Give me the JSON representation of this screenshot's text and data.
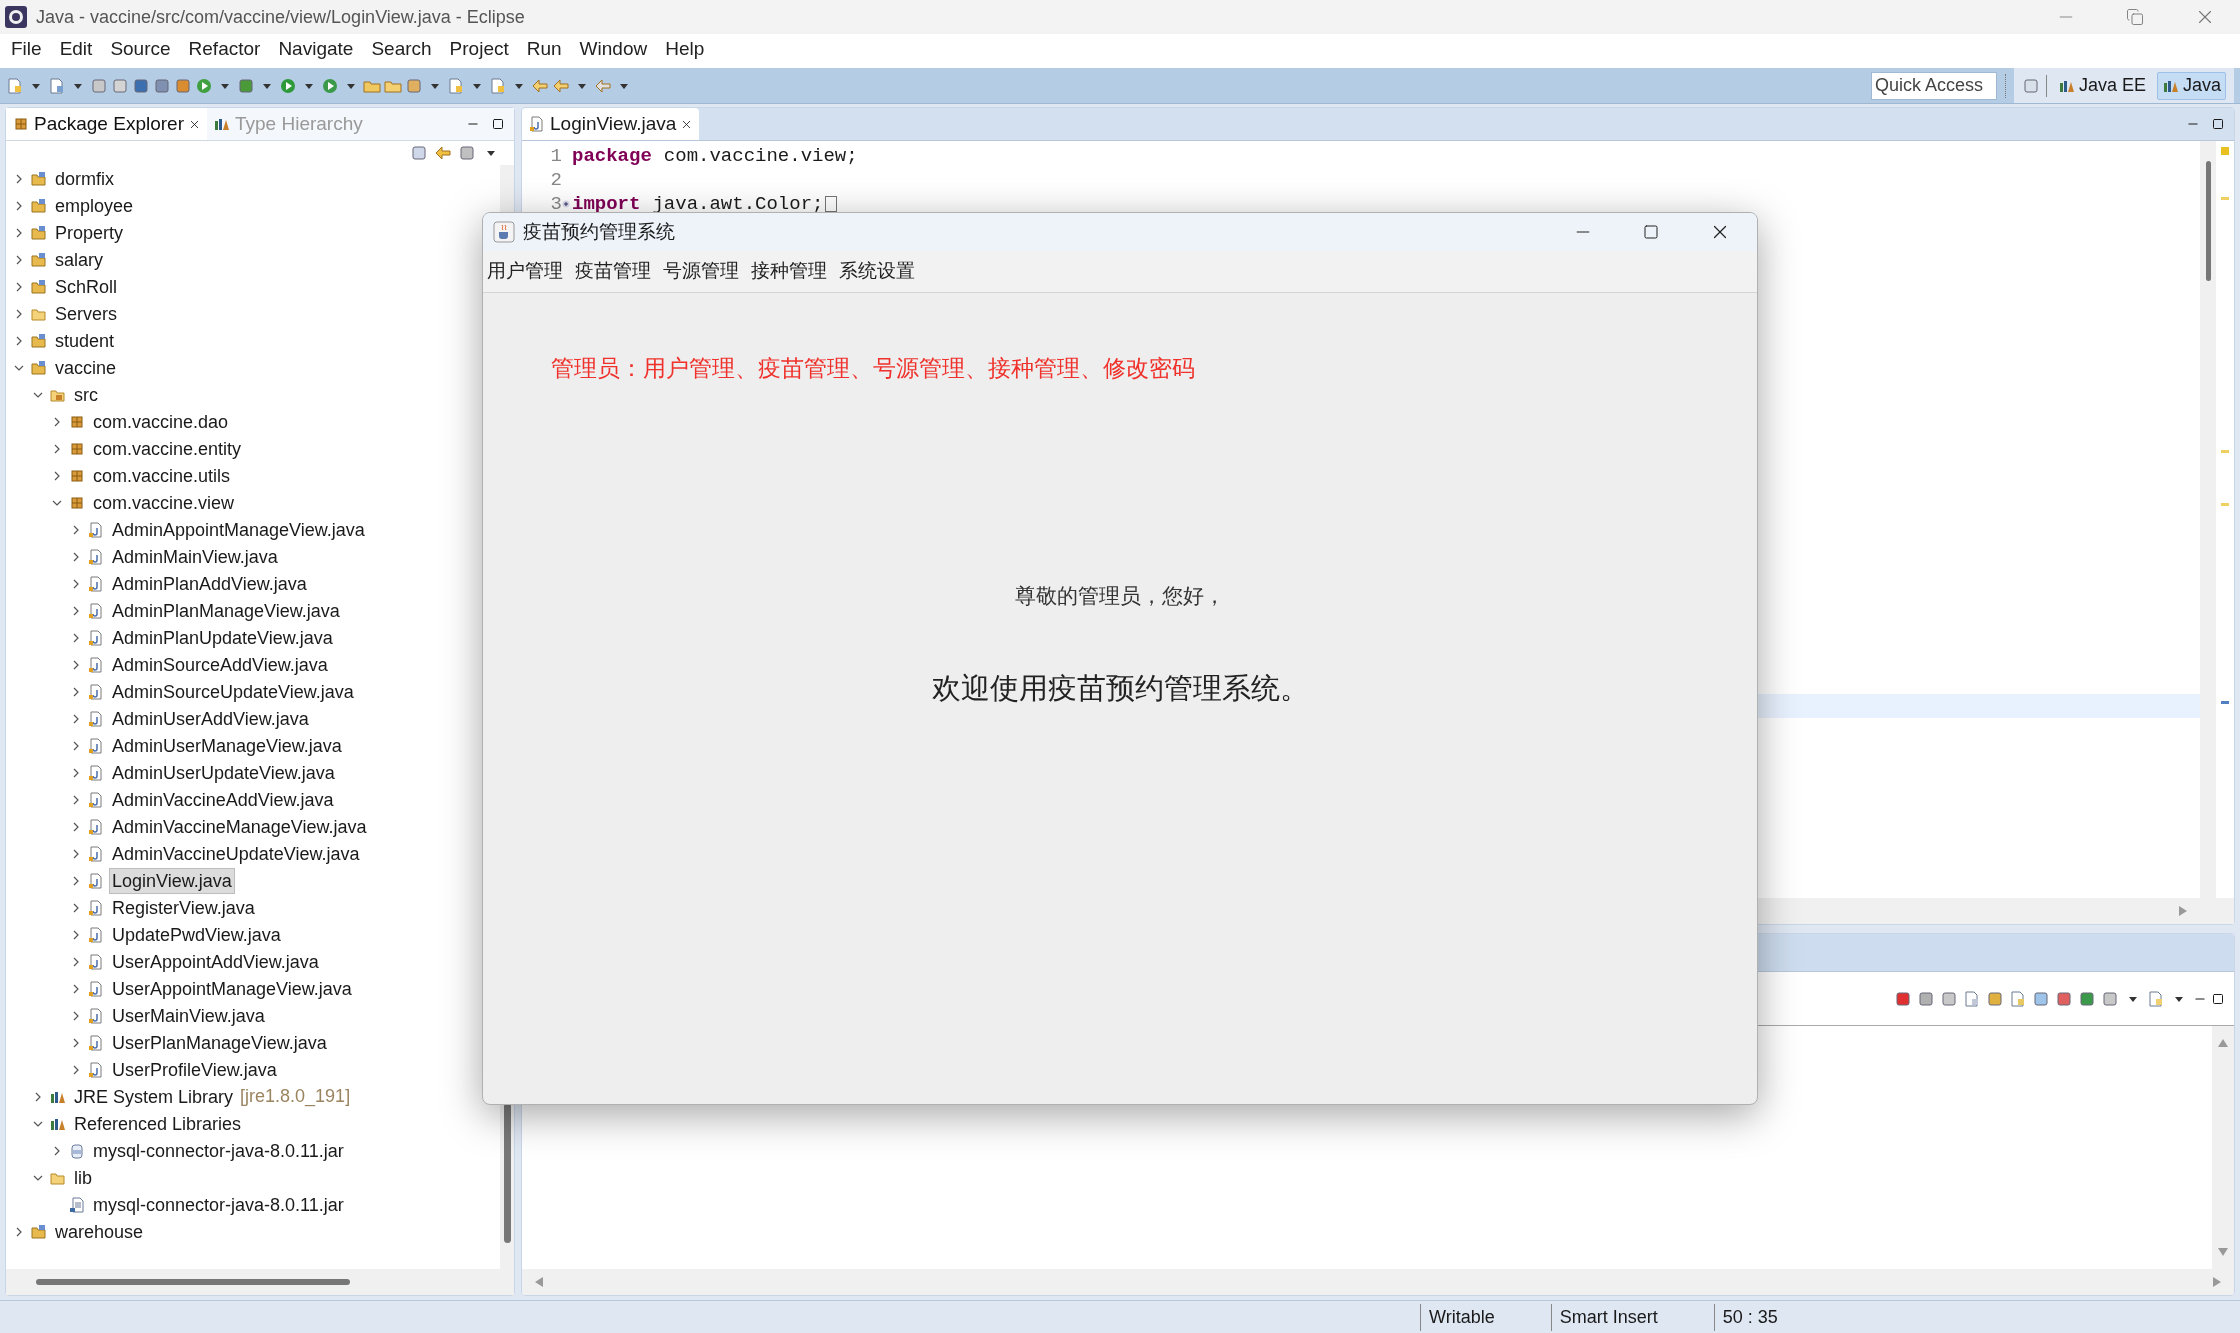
{
  "window": {
    "title": "Java - vaccine/src/com/vaccine/view/LoginView.java - Eclipse"
  },
  "menu": [
    "File",
    "Edit",
    "Source",
    "Refactor",
    "Navigate",
    "Search",
    "Project",
    "Run",
    "Window",
    "Help"
  ],
  "quick_access": {
    "placeholder": "Quick Access"
  },
  "perspectives": [
    {
      "label": "Java EE",
      "selected": false
    },
    {
      "label": "Java",
      "selected": true
    }
  ],
  "left_tabs": [
    {
      "label": "Package Explorer",
      "selected": true
    },
    {
      "label": "Type Hierarchy",
      "selected": false
    }
  ],
  "tree": [
    {
      "label": "dormfix",
      "kind": "project",
      "expanded": false,
      "selected": false
    },
    {
      "label": "employee",
      "kind": "project",
      "expanded": false,
      "selected": false
    },
    {
      "label": "Property",
      "kind": "project",
      "expanded": false,
      "selected": false
    },
    {
      "label": "salary",
      "kind": "project",
      "expanded": false,
      "selected": false
    },
    {
      "label": "SchRoll",
      "kind": "project",
      "expanded": false,
      "selected": false
    },
    {
      "label": "Servers",
      "kind": "folder",
      "expanded": false,
      "selected": false
    },
    {
      "label": "student",
      "kind": "project",
      "expanded": false,
      "selected": false
    },
    {
      "label": "vaccine",
      "kind": "project",
      "expanded": true,
      "selected": false,
      "children": [
        {
          "label": "src",
          "kind": "src",
          "expanded": true,
          "selected": false,
          "children": [
            {
              "label": "com.vaccine.dao",
              "kind": "package",
              "expanded": false,
              "selected": false
            },
            {
              "label": "com.vaccine.entity",
              "kind": "package",
              "expanded": false,
              "selected": false
            },
            {
              "label": "com.vaccine.utils",
              "kind": "package",
              "expanded": false,
              "selected": false
            },
            {
              "label": "com.vaccine.view",
              "kind": "package",
              "expanded": true,
              "selected": false,
              "children": [
                {
                  "label": "AdminAppointManageView.java",
                  "kind": "java",
                  "expanded": false,
                  "selected": false
                },
                {
                  "label": "AdminMainView.java",
                  "kind": "java",
                  "expanded": false,
                  "selected": false
                },
                {
                  "label": "AdminPlanAddView.java",
                  "kind": "java",
                  "expanded": false,
                  "selected": false
                },
                {
                  "label": "AdminPlanManageView.java",
                  "kind": "java",
                  "expanded": false,
                  "selected": false
                },
                {
                  "label": "AdminPlanUpdateView.java",
                  "kind": "java",
                  "expanded": false,
                  "selected": false
                },
                {
                  "label": "AdminSourceAddView.java",
                  "kind": "java",
                  "expanded": false,
                  "selected": false
                },
                {
                  "label": "AdminSourceUpdateView.java",
                  "kind": "java",
                  "expanded": false,
                  "selected": false
                },
                {
                  "label": "AdminUserAddView.java",
                  "kind": "java",
                  "expanded": false,
                  "selected": false
                },
                {
                  "label": "AdminUserManageView.java",
                  "kind": "java",
                  "expanded": false,
                  "selected": false
                },
                {
                  "label": "AdminUserUpdateView.java",
                  "kind": "java",
                  "expanded": false,
                  "selected": false
                },
                {
                  "label": "AdminVaccineAddView.java",
                  "kind": "java",
                  "expanded": false,
                  "selected": false
                },
                {
                  "label": "AdminVaccineManageView.java",
                  "kind": "java",
                  "expanded": false,
                  "selected": false
                },
                {
                  "label": "AdminVaccineUpdateView.java",
                  "kind": "java",
                  "expanded": false,
                  "selected": false
                },
                {
                  "label": "LoginView.java",
                  "kind": "java",
                  "expanded": false,
                  "selected": true
                },
                {
                  "label": "RegisterView.java",
                  "kind": "java",
                  "expanded": false,
                  "selected": false
                },
                {
                  "label": "UpdatePwdView.java",
                  "kind": "java",
                  "expanded": false,
                  "selected": false
                },
                {
                  "label": "UserAppointAddView.java",
                  "kind": "java",
                  "expanded": false,
                  "selected": false
                },
                {
                  "label": "UserAppointManageView.java",
                  "kind": "java",
                  "expanded": false,
                  "selected": false
                },
                {
                  "label": "UserMainView.java",
                  "kind": "java",
                  "expanded": false,
                  "selected": false
                },
                {
                  "label": "UserPlanManageView.java",
                  "kind": "java",
                  "expanded": false,
                  "selected": false
                },
                {
                  "label": "UserProfileView.java",
                  "kind": "java",
                  "expanded": false,
                  "selected": false
                }
              ]
            }
          ]
        },
        {
          "label": "JRE System Library",
          "decoration": "[jre1.8.0_191]",
          "kind": "library",
          "expanded": false,
          "selected": false
        },
        {
          "label": "Referenced Libraries",
          "kind": "library",
          "expanded": true,
          "selected": false,
          "children": [
            {
              "label": "mysql-connector-java-8.0.11.jar",
              "kind": "jar",
              "expanded": false,
              "selected": false
            }
          ]
        },
        {
          "label": "lib",
          "kind": "folder",
          "expanded": true,
          "selected": false,
          "children": [
            {
              "label": "mysql-connector-java-8.0.11.jar",
              "kind": "archive",
              "selected": false
            }
          ]
        }
      ]
    },
    {
      "label": "warehouse",
      "kind": "project",
      "expanded": false,
      "selected": false
    }
  ],
  "editor": {
    "tabs": [
      {
        "label": "LoginView.java",
        "selected": true
      }
    ],
    "lines": [
      {
        "number": "1",
        "keyword": "package",
        "text": "com.vaccine.view;"
      },
      {
        "number": "2"
      },
      {
        "number": "3",
        "keyword": "import",
        "text": "java.awt.Color;",
        "folded": true
      }
    ]
  },
  "dialog": {
    "title": "疫苗预约管理系统",
    "menu": [
      "用户管理",
      "疫苗管理",
      "号源管理",
      "接种管理",
      "系统设置"
    ],
    "notice": "管理员：用户管理、疫苗管理、号源管理、接种管理、修改密码",
    "greeting": "尊敬的管理员，您好，",
    "welcome": "欢迎使用疫苗预约管理系统。"
  },
  "status_bar": [
    "Writable",
    "Smart Insert",
    "50 : 35"
  ]
}
